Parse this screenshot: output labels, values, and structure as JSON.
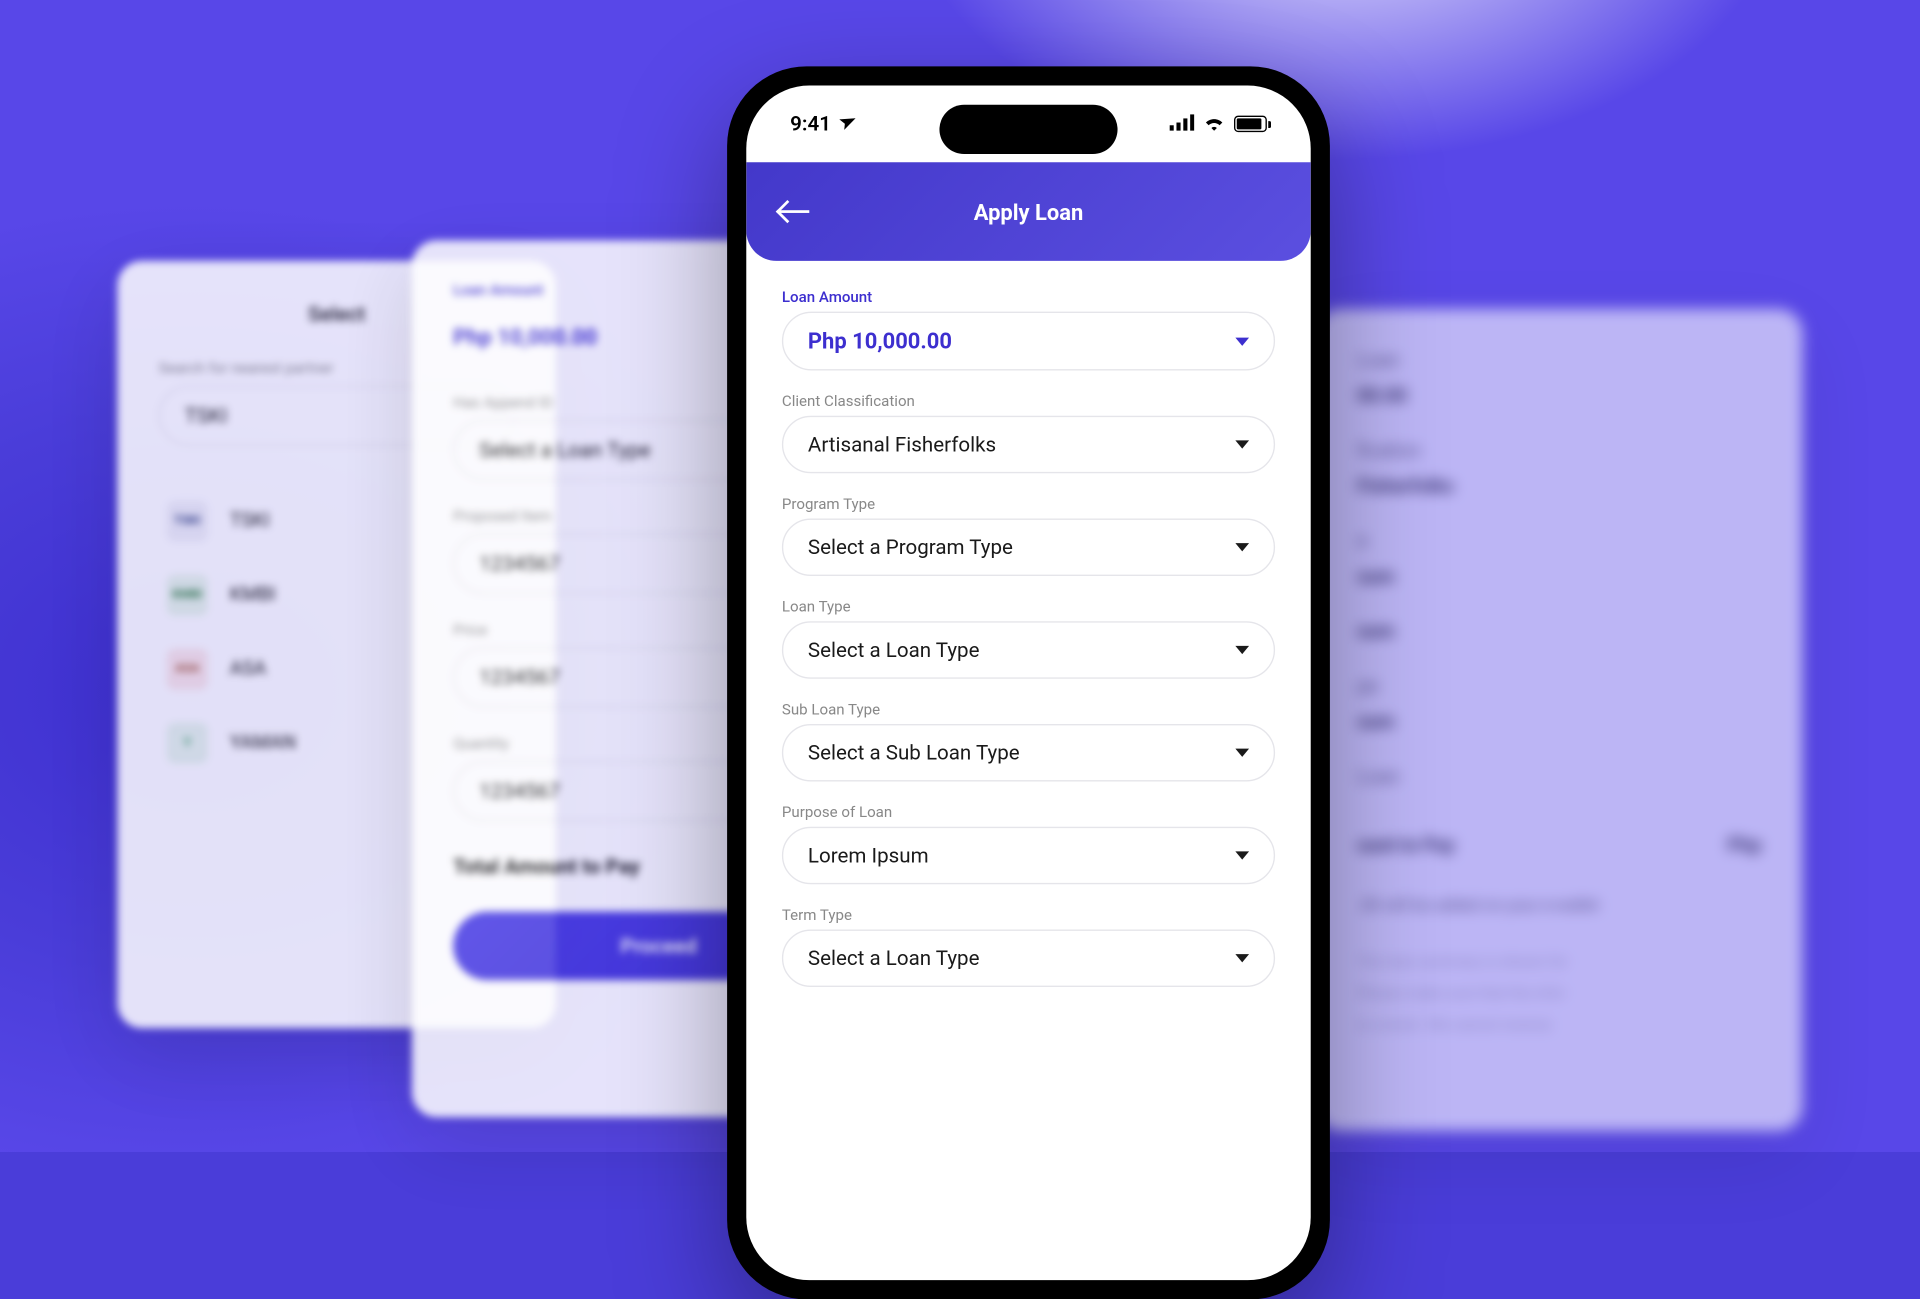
{
  "status_bar": {
    "time": "9:41"
  },
  "header": {
    "title": "Apply Loan"
  },
  "main_form": {
    "loan_amount": {
      "label": "Loan Amount",
      "value": "Php 10,000.00"
    },
    "client_classification": {
      "label": "Client Classification",
      "value": "Artisanal Fisherfolks"
    },
    "program_type": {
      "label": "Program Type",
      "value": "Select a Program Type"
    },
    "loan_type": {
      "label": "Loan Type",
      "value": "Select a Loan Type"
    },
    "sub_loan_type": {
      "label": "Sub Loan Type",
      "value": "Select a Sub Loan Type"
    },
    "purpose_of_loan": {
      "label": "Purpose of Loan",
      "value": "Lorem Ipsum"
    },
    "term_type": {
      "label": "Term Type",
      "value": "Select a Loan Type"
    }
  },
  "card_left": {
    "title": "Select",
    "search": {
      "label": "Search for nearest partner",
      "value": "TSKI"
    },
    "partners": [
      {
        "name": "TSKI",
        "icon": "TSKI"
      },
      {
        "name": "KMBI",
        "icon": "KMBI"
      },
      {
        "name": "ASA",
        "icon": "ASA"
      },
      {
        "name": "YAMAN",
        "icon": "Y"
      }
    ]
  },
  "card_mid": {
    "loan_amount": {
      "label": "Loan Amount",
      "value": "Php 10,000.00"
    },
    "has_append_id": {
      "label": "Has Append ID",
      "value": "Select a Loan Type"
    },
    "proposed_item": {
      "label": "Proposed Item",
      "value": "1234567"
    },
    "price": {
      "label": "Price",
      "value": "1234567"
    },
    "quantity": {
      "label": "Quantity",
      "value": "1234567"
    },
    "total_label": "Total Amount to Pay",
    "proceed_label": "Proceed"
  },
  "card_right": {
    "loan_label": "Loan",
    "amount": "00.00",
    "classification_label": "fication",
    "classification_value": "Fisherfolks",
    "row3_label": "e",
    "row3_value": "sum",
    "row4_value": "sum",
    "row5_label": "pe",
    "row5_value": "sum",
    "row6_label": "Loan",
    "total_label": "ount to Pay",
    "total_value": "Php",
    "wallet_note": ".00 will be added on your e-wallet",
    "disclaimer1": "The loan summary is shown for",
    "disclaimer2": "Please make sure that the infor",
    "disclaimer3": "is correct. We cannot reverse"
  }
}
